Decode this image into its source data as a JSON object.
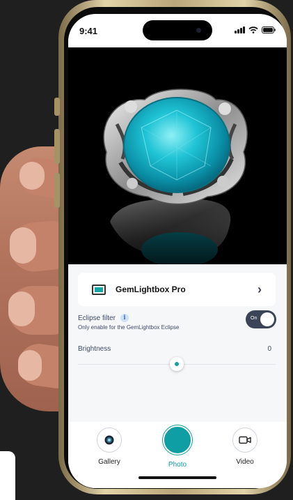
{
  "status_bar": {
    "time": "9:41"
  },
  "device_selector": {
    "name": "GemLightbox Pro"
  },
  "eclipse_filter": {
    "title": "Eclipse filter",
    "subtitle": "Only enable for the GemLightbox Eclipse",
    "toggle_label": "On"
  },
  "brightness": {
    "label": "Brightness",
    "value": "0",
    "level": 0.5
  },
  "bottom_nav": {
    "gallery": "Gallery",
    "photo": "Photo",
    "video": "Video"
  },
  "colors": {
    "accent": "#0e9ea3",
    "toggle_bg": "#3c4558",
    "panel_bg": "#f6f7f9"
  }
}
